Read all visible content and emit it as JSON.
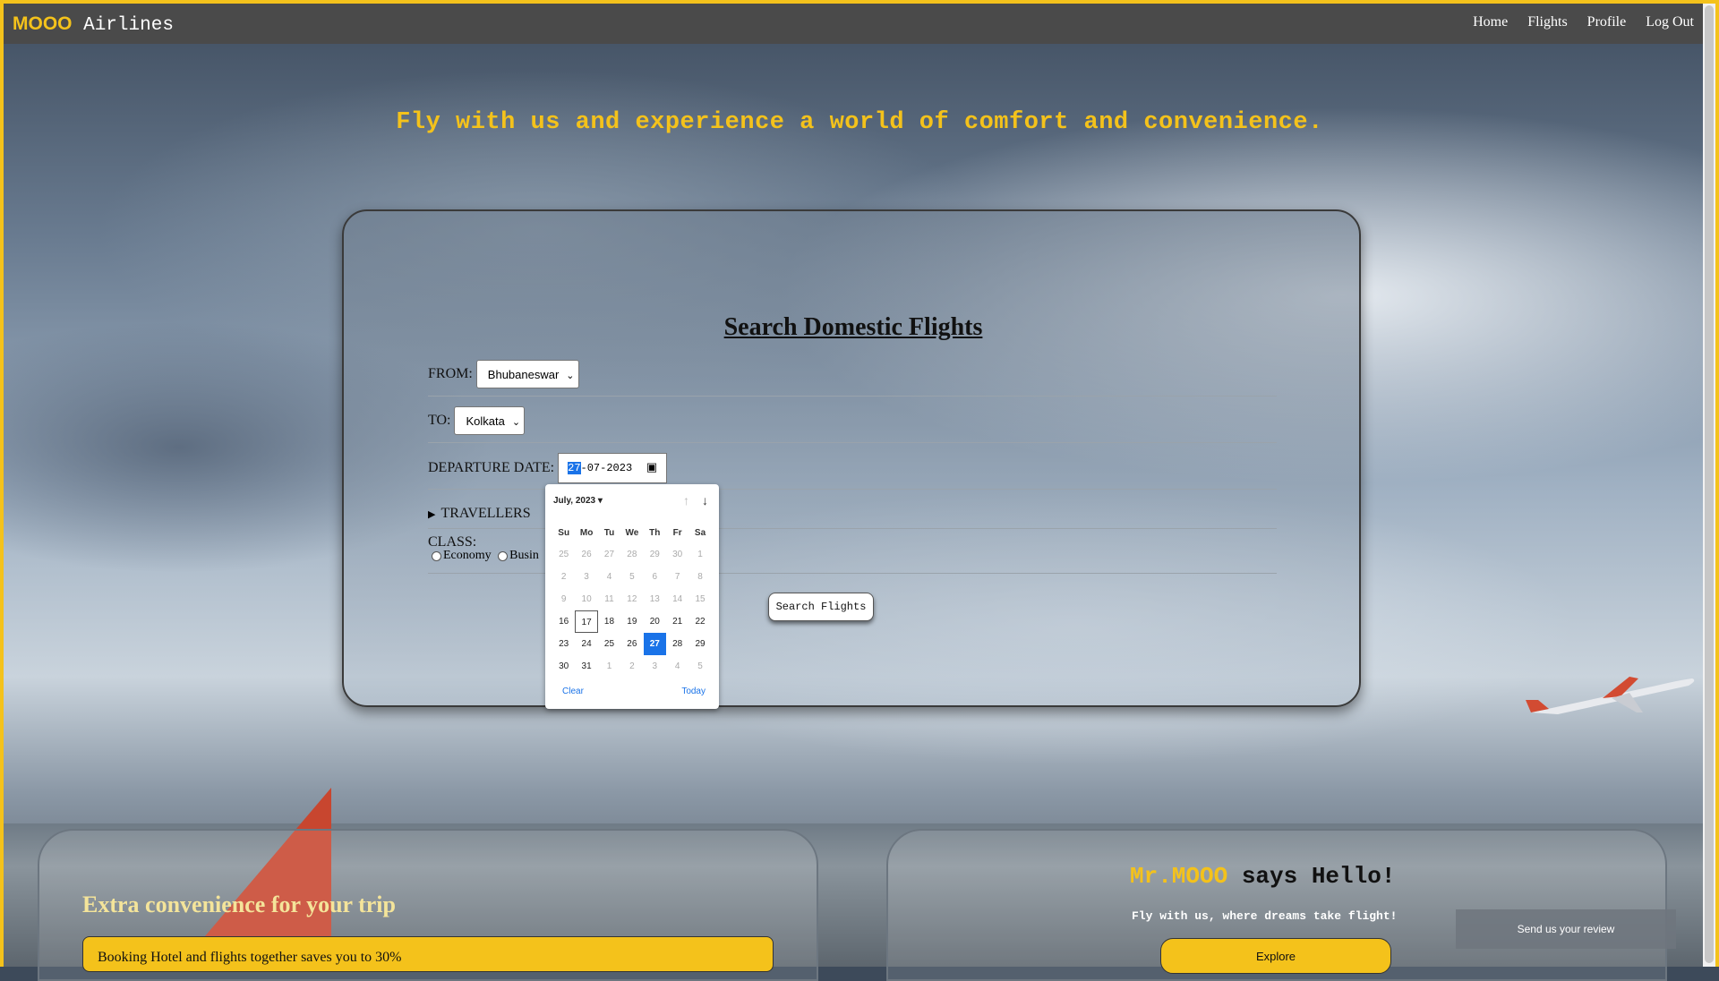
{
  "nav": {
    "brand_strong": "MOOO",
    "brand_rest": " Airlines",
    "links": [
      "Home",
      "Flights",
      "Profile",
      "Log Out"
    ]
  },
  "tagline": "Fly with us and experience a world of comfort and convenience.",
  "search": {
    "title": "Search Domestic Flights",
    "from_label": "FROM:",
    "from_value": "Bhubaneswar",
    "to_label": "TO:",
    "to_value": "Kolkata",
    "date_label": "DEPARTURE DATE:",
    "date_day": "27",
    "date_rest": "-07-2023",
    "travellers_label": "TRAVELLERS",
    "class_label": "CLASS:",
    "class_options": [
      "Economy",
      "Busin"
    ],
    "button": "Search Flights"
  },
  "calendar": {
    "month": "July, 2023",
    "weekdays": [
      "Su",
      "Mo",
      "Tu",
      "We",
      "Th",
      "Fr",
      "Sa"
    ],
    "weeks": [
      [
        "25",
        "26",
        "27",
        "28",
        "29",
        "30",
        "1"
      ],
      [
        "2",
        "3",
        "4",
        "5",
        "6",
        "7",
        "8"
      ],
      [
        "9",
        "10",
        "11",
        "12",
        "13",
        "14",
        "15"
      ],
      [
        "16",
        "17",
        "18",
        "19",
        "20",
        "21",
        "22"
      ],
      [
        "23",
        "24",
        "25",
        "26",
        "27",
        "28",
        "29"
      ],
      [
        "30",
        "31",
        "1",
        "2",
        "3",
        "4",
        "5"
      ]
    ],
    "today": "17",
    "selected": "27",
    "clear": "Clear",
    "today_label": "Today"
  },
  "promo": {
    "title": "Extra convenience for your trip",
    "offer": "Booking Hotel and flights together saves you to 30%"
  },
  "hello": {
    "mr": "Mr.MOOO",
    "rest": " says Hello!",
    "sub": "Fly with us, where dreams take flight!",
    "explore": "Explore"
  },
  "review": "Send us your review",
  "colors": {
    "accent": "#f4c21b",
    "nav_bg": "#4a4a4a",
    "selected_day": "#1a73e8"
  }
}
